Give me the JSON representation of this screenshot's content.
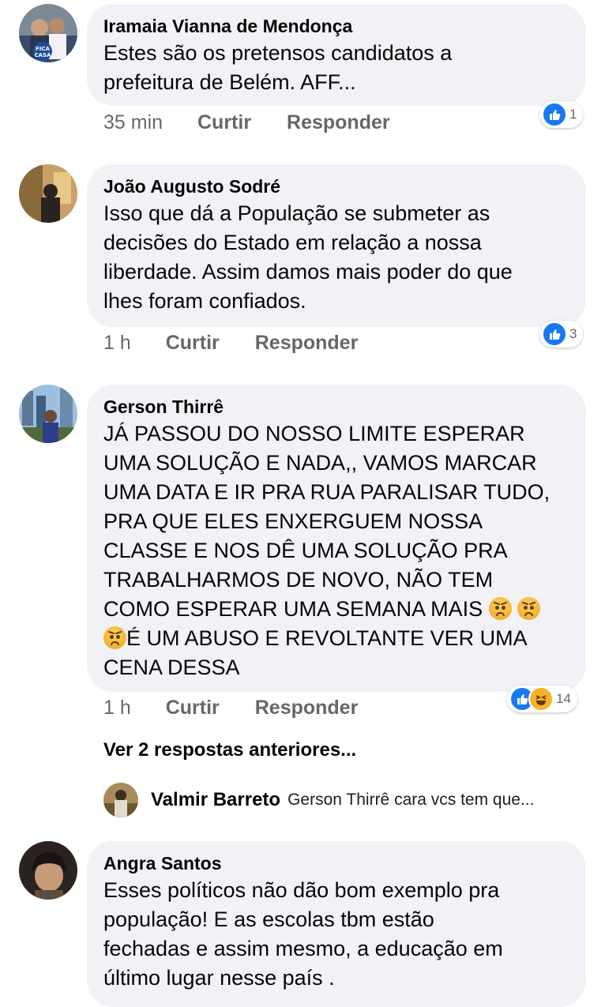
{
  "comments": [
    {
      "name": "Iramaia Vianna de Mendonça",
      "text": "Estes são os pretensos candidatos a\nprefeitura de Belém. AFF...",
      "time": "35 min",
      "like": "Curtir",
      "reply": "Responder",
      "reaction_count": "1",
      "avatar_badge": "FICA CASA"
    },
    {
      "name": "João Augusto Sodré",
      "text": "Isso que dá a População se submeter as\ndecisões do Estado em relação a nossa\nliberdade. Assim damos mais poder do que\nlhes foram confiados.",
      "time": "1 h",
      "like": "Curtir",
      "reply": "Responder",
      "reaction_count": "3"
    },
    {
      "name": "Gerson Thirrê",
      "text_lines": [
        "JÁ PASSOU DO NOSSO LIMITE ESPERAR",
        "UMA SOLUÇÃO E NADA,, VAMOS MARCAR",
        "UMA DATA E IR PRA RUA PARALISAR TUDO,",
        "PRA QUE ELES ENXERGUEM NOSSA",
        "CLASSE E NOS DÊ UMA SOLUÇÃO PRA",
        "TRABALHARMOS DE NOVO, NÃO TEM",
        "COMO ESPERAR UMA SEMANA MAIS",
        "É UM ABUSO E REVOLTANTE VER UMA",
        "CENA DESSA"
      ],
      "time": "1 h",
      "like": "Curtir",
      "reply": "Responder",
      "reaction_count": "14"
    },
    {
      "name": "Angra Santos",
      "text": "Esses políticos não dão bom exemplo pra\npopulação! E as escolas tbm estão\nfechadas e assim mesmo, a educação em\núltimo lugar nesse país ."
    }
  ],
  "more_replies": "Ver 2 respostas anteriores...",
  "reply_preview": {
    "name": "Valmir Barreto",
    "text": "Gerson Thirrê cara vcs tem que..."
  },
  "colors": {
    "bubble": "#f0f2f5",
    "like_blue": "#1877f2",
    "meta_gray": "#65676b"
  },
  "icons": [
    "like-icon",
    "haha-icon",
    "angry-emoji"
  ]
}
